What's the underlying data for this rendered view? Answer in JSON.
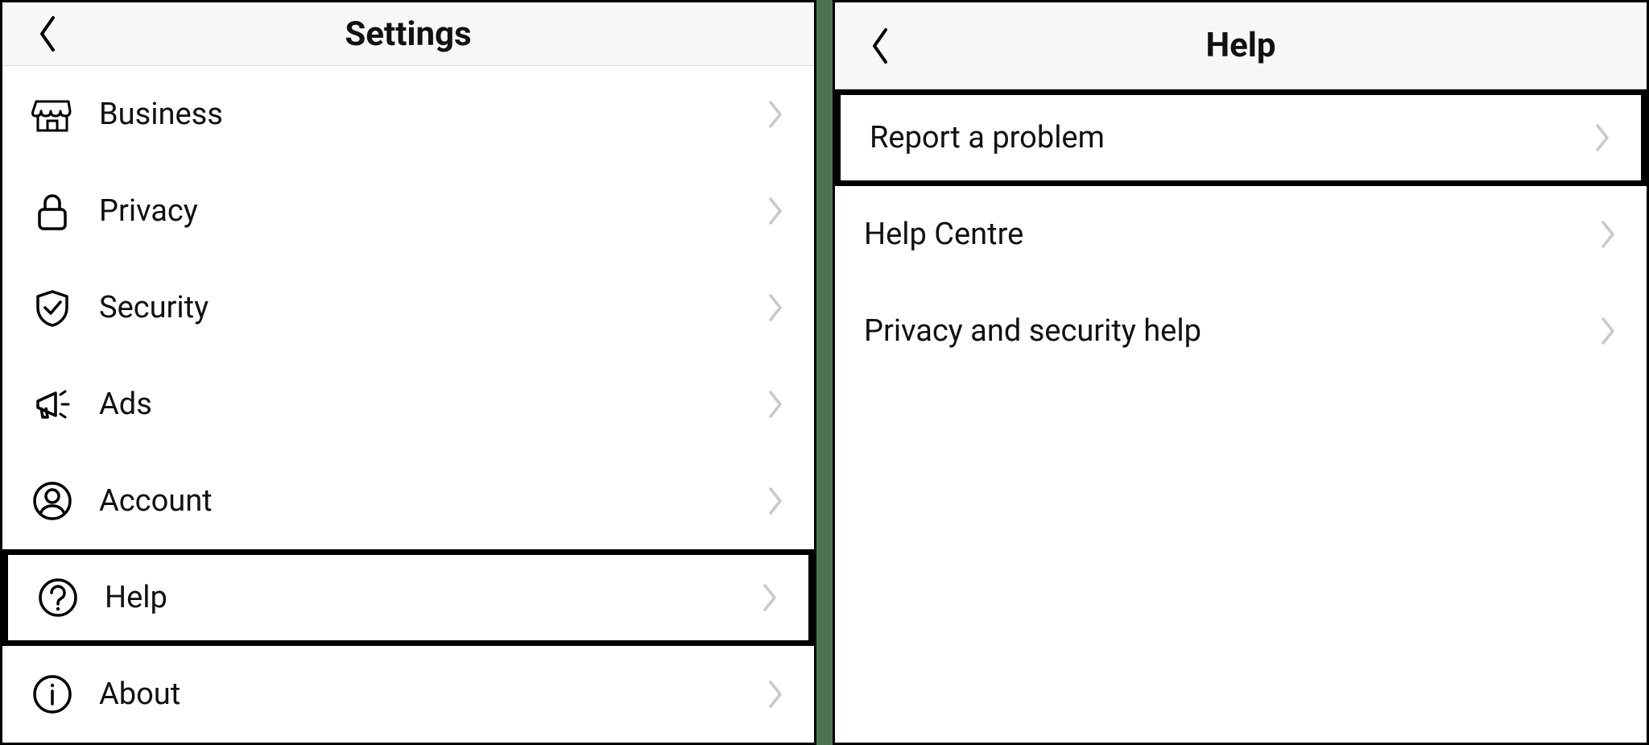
{
  "left": {
    "title": "Settings",
    "items": [
      {
        "id": "business",
        "label": "Business",
        "icon": "storefront"
      },
      {
        "id": "privacy",
        "label": "Privacy",
        "icon": "lock"
      },
      {
        "id": "security",
        "label": "Security",
        "icon": "shield-check"
      },
      {
        "id": "ads",
        "label": "Ads",
        "icon": "megaphone"
      },
      {
        "id": "account",
        "label": "Account",
        "icon": "user-circle"
      },
      {
        "id": "help",
        "label": "Help",
        "icon": "question-circle",
        "highlight": true
      },
      {
        "id": "about",
        "label": "About",
        "icon": "info-circle"
      }
    ]
  },
  "right": {
    "title": "Help",
    "items": [
      {
        "id": "report",
        "label": "Report a problem",
        "highlight": true
      },
      {
        "id": "centre",
        "label": "Help Centre"
      },
      {
        "id": "privsec",
        "label": "Privacy and security help"
      }
    ]
  }
}
